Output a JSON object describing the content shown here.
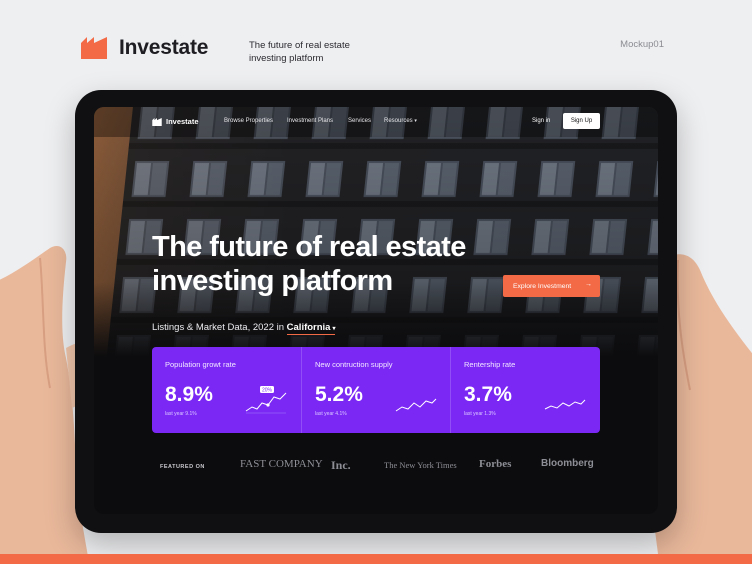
{
  "presentation": {
    "brand": "Investate",
    "tagline": "The future of real estate investing platform",
    "mockup_label": "Mockup01",
    "accent": "#f26a46"
  },
  "nav": {
    "brand": "Investate",
    "items": [
      "Browse Properties",
      "Investment Plans",
      "Services",
      "Resources"
    ],
    "signin": "Sign in",
    "signup": "Sign Up"
  },
  "hero": {
    "title": "The future of real estate investing platform",
    "cta": "Explore Investment",
    "listing_prefix": "Listings & Market Data, 2022 in",
    "listing_state": "California"
  },
  "stats": [
    {
      "label": "Population growt rate",
      "value": "8.9%",
      "sub": "last year 9.1%",
      "badge": "20%"
    },
    {
      "label": "New contruction supply",
      "value": "5.2%",
      "sub": "last year 4.1%"
    },
    {
      "label": "Rentership rate",
      "value": "3.7%",
      "sub": "last year 1.3%"
    }
  ],
  "featured": {
    "label": "FEATURED ON",
    "logos": [
      "FAST COMPANY",
      "Inc.",
      "The New York Times",
      "Forbes",
      "Bloomberg"
    ]
  },
  "colors": {
    "stats_panel": "#7b28f5",
    "bottom_bar": "#f26a46",
    "background": "#eeeff1"
  }
}
